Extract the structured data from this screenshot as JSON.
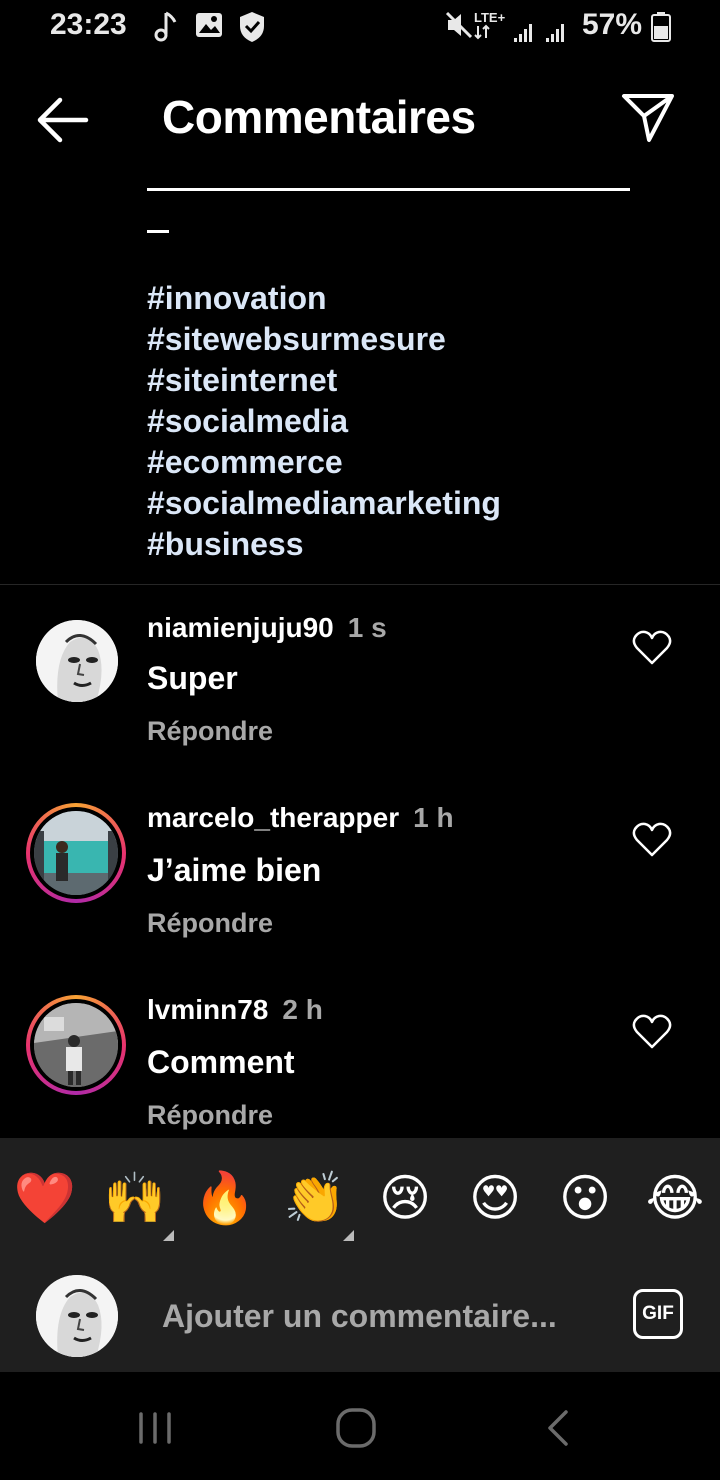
{
  "status_bar": {
    "time": "23:23",
    "network": "LTE+",
    "battery": "57%",
    "icons": [
      "music-note-icon",
      "gallery-icon",
      "shield-icon",
      "mute-icon",
      "signal-icon",
      "battery-icon"
    ]
  },
  "header": {
    "title": "Commentaires",
    "back_icon": "arrow-left-icon",
    "send_icon": "paper-plane-icon"
  },
  "caption": {
    "hashtags": [
      "#innovation",
      "#sitewebsurmesure",
      "#siteinternet",
      "#socialmedia",
      "#ecommerce",
      "#socialmediamarketing",
      "#business"
    ]
  },
  "comments": [
    {
      "username": "niamienjuju90",
      "time": "1 s",
      "text": "Super",
      "reply_label": "Répondre",
      "story_ring": false
    },
    {
      "username": "marcelo_therapper",
      "time": "1 h",
      "text": "J’aime bien",
      "reply_label": "Répondre",
      "story_ring": true
    },
    {
      "username": "lvminn78",
      "time": "2 h",
      "text": "Comment",
      "reply_label": "Répondre",
      "story_ring": true
    }
  ],
  "emoji_bar": [
    "❤️",
    "🙌",
    "🔥",
    "👏",
    "😢",
    "😍",
    "😮",
    "😂"
  ],
  "composer": {
    "placeholder": "Ajouter un commentaire...",
    "gif_label": "GIF"
  },
  "nav_bar": {
    "icons": [
      "recent-apps-icon",
      "home-icon",
      "back-icon"
    ]
  },
  "colors": {
    "background": "#000000",
    "hashtag": "#dbe7f7",
    "secondary_text": "#a8a8a8",
    "composer_bg": "#1f1f1f"
  }
}
